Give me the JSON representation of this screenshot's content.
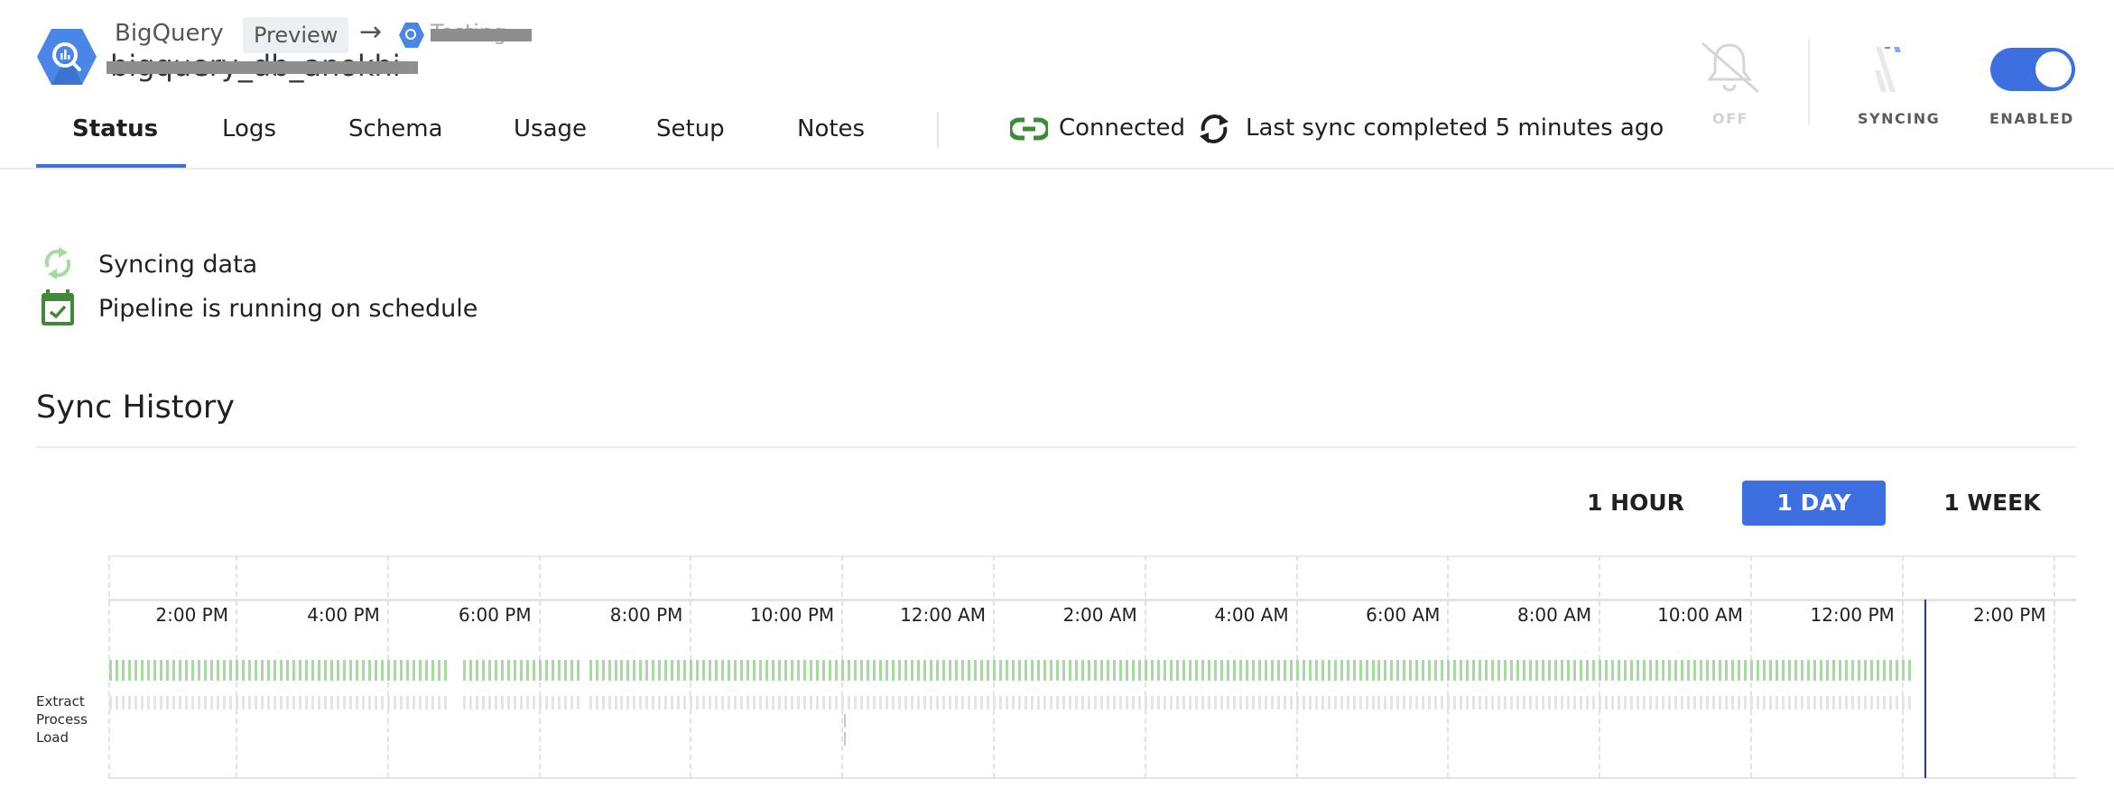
{
  "header": {
    "source_name": "BigQuery",
    "badge": "Preview",
    "destination_name": "Testing",
    "connector_name": "bigquery_db_anokhi",
    "logo_icon": "bigquery-hexagon-icon",
    "accent_color": "#3d6fe0"
  },
  "tabs": [
    {
      "label": "Status",
      "active": true
    },
    {
      "label": "Logs",
      "active": false
    },
    {
      "label": "Schema",
      "active": false
    },
    {
      "label": "Usage",
      "active": false
    },
    {
      "label": "Setup",
      "active": false
    },
    {
      "label": "Notes",
      "active": false
    }
  ],
  "connection": {
    "status": "Connected",
    "status_color": "#3f8a36",
    "last_sync": "Last sync completed 5 minutes ago"
  },
  "controls": {
    "alerts_label": "OFF",
    "syncing_label": "SYNCING",
    "enabled_label": "ENABLED",
    "enabled": true
  },
  "status_lines": [
    {
      "icon": "sync-icon",
      "text": "Syncing data"
    },
    {
      "icon": "calendar-check-icon",
      "text": "Pipeline is running on schedule"
    }
  ],
  "sync_history": {
    "title": "Sync History",
    "ranges": [
      {
        "label": "1 HOUR",
        "active": false
      },
      {
        "label": "1 DAY",
        "active": true
      },
      {
        "label": "1 WEEK",
        "active": false
      }
    ],
    "row_labels": [
      "Extract",
      "Process",
      "Load"
    ]
  },
  "chart_data": {
    "type": "timeline",
    "x_ticks": [
      "2:00 PM",
      "4:00 PM",
      "6:00 PM",
      "8:00 PM",
      "10:00 PM",
      "12:00 AM",
      "2:00 AM",
      "4:00 AM",
      "6:00 AM",
      "8:00 AM",
      "10:00 AM",
      "12:00 PM",
      "2:00 PM"
    ],
    "grid": true,
    "sync_interval_minutes": 5,
    "sync_runs": [
      {
        "start": "12:20 PM",
        "end": "4:48 PM"
      },
      {
        "start": "5:00 PM",
        "end": "6:32 PM"
      },
      {
        "start": "6:40 PM",
        "end": "12:08 PM (next day)"
      }
    ],
    "process_load_event": "10:02 PM",
    "current_time": "12:18 PM (next day)",
    "colors": {
      "sync": "#a9d9a2",
      "extract": "#e3e3e8",
      "process_load": "#c8c8cc",
      "now": "#2c3a7a"
    }
  }
}
